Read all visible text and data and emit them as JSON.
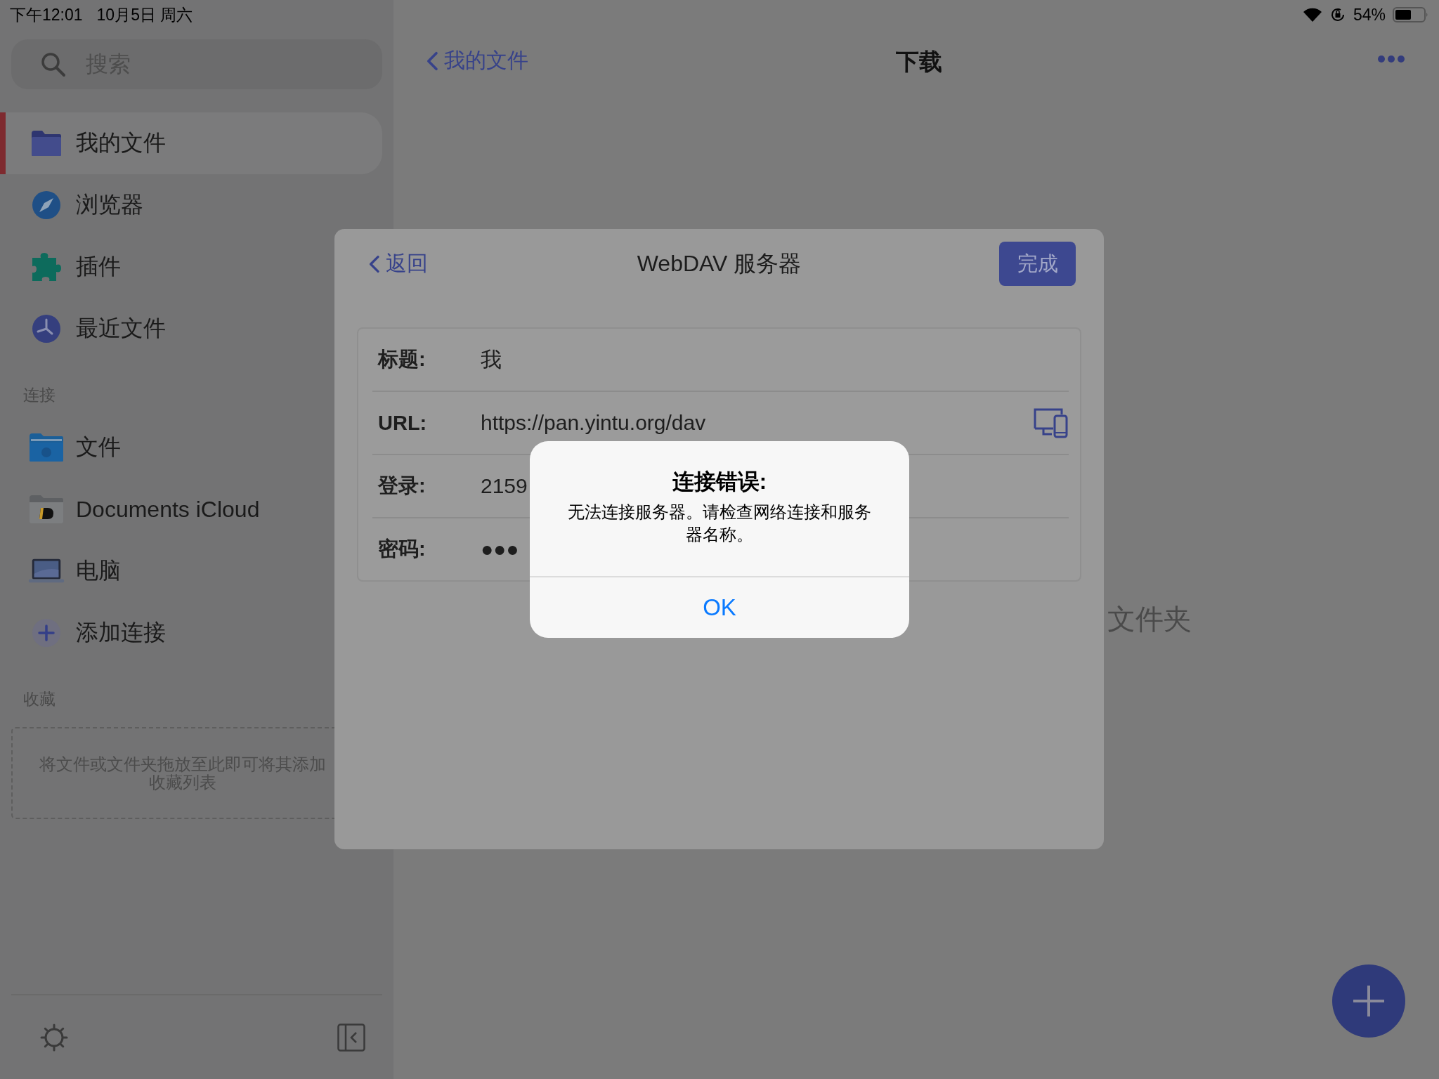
{
  "status_bar": {
    "time": "下午12:01",
    "date": "10月5日 周六",
    "battery": "54%"
  },
  "sidebar": {
    "search": {
      "placeholder": "搜索"
    },
    "items": [
      {
        "kind": "folder",
        "label": "我的文件",
        "selected": true
      },
      {
        "kind": "compass",
        "label": "浏览器",
        "selected": false
      },
      {
        "kind": "puzzle",
        "label": "插件",
        "selected": false
      },
      {
        "kind": "clock",
        "label": "最近文件",
        "selected": false
      }
    ],
    "connections_title": "连接",
    "connections": [
      {
        "kind": "files",
        "label": "文件",
        "selected": false
      },
      {
        "kind": "documents",
        "label": "Documents iCloud",
        "selected": false
      },
      {
        "kind": "laptop",
        "label": "电脑",
        "selected": false
      },
      {
        "kind": "add",
        "label": "添加连接",
        "selected": false
      }
    ],
    "favorites_title": "收藏",
    "favorites_hint": "将文件或文件夹拖放至此即可将其添加收藏列表"
  },
  "nav": {
    "back": "我的文件",
    "title": "下载"
  },
  "empty_text": "文件夹",
  "sheet": {
    "back": "返回",
    "title": "WebDAV 服务器",
    "done": "完成",
    "fields": [
      {
        "kind": "text",
        "label": "标题:",
        "value": "我"
      },
      {
        "kind": "url",
        "label": "URL:",
        "value": "https://pan.yintu.org/dav"
      },
      {
        "kind": "text",
        "label": "登录:",
        "value": "2159"
      },
      {
        "kind": "text",
        "label": "密码:",
        "value": "●●●"
      }
    ]
  },
  "alert": {
    "title": "连接错误:",
    "message": "无法连接服务器。请检查网络连接和服务器名称。",
    "button": "OK"
  }
}
